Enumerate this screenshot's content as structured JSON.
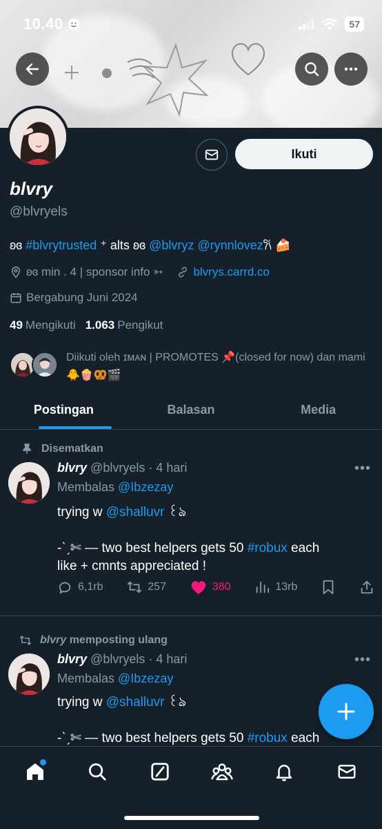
{
  "status_bar": {
    "time": "10.40",
    "battery": "57"
  },
  "profile": {
    "name": "blvry",
    "handle": "@blvryels",
    "follow_label": "Ikuti",
    "bio": {
      "prefix": "ʚɞ ",
      "hashtag": "#blvrytrusted",
      "mid": " ⁺ alts ʚɞ ",
      "mention1": "@blvryz",
      "space": " ",
      "mention2": "@rynnlovez",
      "suffix": "𐙚 🍰"
    },
    "location": "ʚɞ min . 4 | sponsor info ➳",
    "website": "blvrys.carrd.co",
    "joined": "Bergabung Juni 2024",
    "following_count": "49",
    "following_label": "Mengikuti",
    "followers_count": "1.063",
    "followers_label": "Pengikut",
    "followed_by": "Diikuti oleh ɪᴍᴀɴ | PROMOTES 📌(closed for now) dan mami🐥🍿🥨🎬"
  },
  "tabs": [
    {
      "label": "Postingan",
      "active": true
    },
    {
      "label": "Balasan",
      "active": false
    },
    {
      "label": "Media",
      "active": false
    }
  ],
  "posts": [
    {
      "label": "Disematkan",
      "author": "blvry",
      "handle_time": "@blvryels · 4 hari",
      "reply_prefix": "Membalas ",
      "reply_to": "@Ibzezay",
      "line1_prefix": "trying w ",
      "line1_mention": "@shalluvr",
      "line1_suffix": " ꒰ঌ",
      "line2_prefix": "-ˋˏ✄ — two best helpers gets 50 ",
      "line2_hashtag": "#robux",
      "line2_suffix": " each",
      "line3": "like + cmnts appreciated !",
      "replies": "6,1rb",
      "reposts": "257",
      "likes": "380",
      "views": "13rb"
    },
    {
      "label_author": "blvry",
      "label_suffix": " memposting ulang",
      "author": "blvry",
      "handle_time": "@blvryels · 4 hari",
      "reply_prefix": "Membalas ",
      "reply_to": "@Ibzezay",
      "line1_prefix": "trying w ",
      "line1_mention": "@shalluvr",
      "line1_suffix": " ꒰ঌ",
      "line2_prefix": "-ˋˏ✄ — two best helpers gets 50 ",
      "line2_hashtag": "#robux",
      "line2_suffix": " each"
    }
  ],
  "colors": {
    "background": "#15202b",
    "accent": "#1d9bf0",
    "like": "#f91880",
    "muted": "#8b98a5"
  }
}
